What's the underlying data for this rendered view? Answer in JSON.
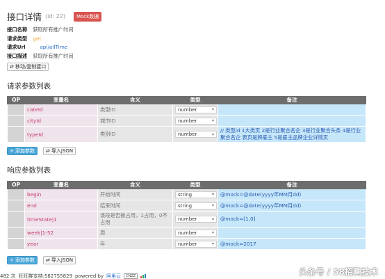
{
  "header": {
    "title": "接口详情",
    "id_text": "(id: 22)",
    "mock_label": "Mock数据"
  },
  "info": [
    {
      "label": "接口名称",
      "value": "获取所有推广时间"
    },
    {
      "label": "请求类型",
      "value": "get"
    },
    {
      "label": "请求Url",
      "value": "api/allTime"
    },
    {
      "label": "接口描述",
      "value": "获取所有推广时间"
    }
  ],
  "actions": {
    "move_copy_label": "移动/复制接口"
  },
  "request": {
    "title": "请求参数列表",
    "headers": [
      "OP",
      "变量名",
      "含义",
      "类型",
      "备注"
    ],
    "rows": [
      {
        "name": "cateId",
        "meaning": "类型ID",
        "type": "number",
        "note": ""
      },
      {
        "name": "cityId",
        "meaning": "城市ID",
        "type": "number",
        "note": ""
      },
      {
        "name": "typeId",
        "meaning": "类别ID",
        "type": "number",
        "note": "// 类型id 1大类页 2是行业聚合名企 3是行业聚合头条 4是行业聚合名企 表页是牌雇主 5是雇主品牌企业详情页"
      }
    ],
    "add_label": "添加参数",
    "import_label": "导入JSON"
  },
  "response": {
    "title": "响应参数列表",
    "headers": [
      "OP",
      "变量名",
      "含义",
      "类型",
      "备注"
    ],
    "rows": [
      {
        "name": "begin",
        "meaning": "开始时间",
        "type": "string",
        "note": "@mock=@date(yyyy年MM月dd)"
      },
      {
        "name": "end",
        "meaning": "结束时间",
        "type": "string",
        "note": "@mock=@date(yyyy年MM月dd)"
      },
      {
        "name": "timeState|1",
        "meaning": "该段是否被占用，1占用，0不占用",
        "type": "number",
        "note": "@mock=[1,0]"
      },
      {
        "name": "week|1-52",
        "meaning": "周",
        "type": "number",
        "note": ""
      },
      {
        "name": "year",
        "meaning": "年",
        "type": "number",
        "note": "@mock=2017"
      }
    ],
    "add_label": "添加参数",
    "import_label": "导入JSON"
  },
  "footer": {
    "visits": "482 次",
    "support": "旺旺群支持:582755829",
    "powered": "powered by",
    "host": "阿里云",
    "cnzz": "CNZZ"
  },
  "watermark": "头条号 / 58招聘技术",
  "colors": {
    "accent": "#4aa7d8",
    "badge": "#d9534f",
    "header_bg": "#6d6d6d",
    "row_bg": "#c6e6fa"
  }
}
